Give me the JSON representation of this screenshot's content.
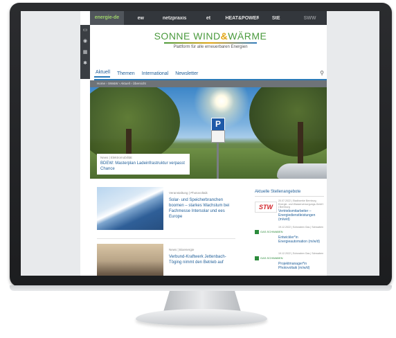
{
  "partners": [
    {
      "label": "energie-de",
      "active": true
    },
    {
      "label": "ew",
      "active": false
    },
    {
      "label": "netzpraxis",
      "active": false
    },
    {
      "label": "et",
      "active": false
    },
    {
      "label": "HEAT&POWER",
      "active": false
    },
    {
      "label": "StE",
      "active": false
    },
    {
      "label": "SWW",
      "active": false,
      "dim": true
    }
  ],
  "sidebar": {
    "icons": [
      "window-icon",
      "eye-icon",
      "calendar-icon",
      "gear-icon"
    ]
  },
  "logo": {
    "part1": "SONNE WIND",
    "amp": "&",
    "part2": "WÄRME",
    "subtitle": "Plattform für alle erneuerbaren Energien",
    "colors": {
      "green": "#4a9a3d",
      "amber": "#e2a413",
      "blue": "#2e7bbf"
    }
  },
  "nav": {
    "items": [
      "Aktuell",
      "Themen",
      "International",
      "Newsletter"
    ],
    "active": "Aktuell",
    "search_icon": "search-icon"
  },
  "breadcrumb": "Home › SW&W › Aktuell › Übersicht",
  "hero": {
    "category": "News | Elektromobilität",
    "title": "BDEW: Masterplan Ladeinfrastruktur verpasst Chance"
  },
  "articles": [
    {
      "category": "Veranstaltung | Photovoltaik",
      "title": "Solar- und Speicherbranchen boomen – starkes Wachstum bei Fachmesse Intersolar und ees Europe"
    },
    {
      "category": "News | Bioenergie",
      "title": "Verbund-Kraftwerk Jettenbach-Töging nimmt den Betrieb auf"
    }
  ],
  "jobs": {
    "heading": "Aktuelle Stellenangebote",
    "items": [
      {
        "logo": "STW",
        "meta": "20.07.2022 | Stadtwerke Bernburg Energie- und Wasserversorgungs-GmbH | Bernburg",
        "title": "Vertriebsmitarbeiter – Energiedienstleistungen (m/w/d)"
      },
      {
        "logo": "GAS.SCHWABEN",
        "meta": "19.12.2022 | Schwaben Gas | Schwaben",
        "title": "Entwickler*in Energieautomation (m/w/d)"
      },
      {
        "logo": "GAS.SCHWABEN",
        "meta": "19.12.2022 | Schwaben Gas | Schwaben",
        "title": "Projektmanager*in Photovoltaik (m/w/d)"
      }
    ]
  }
}
